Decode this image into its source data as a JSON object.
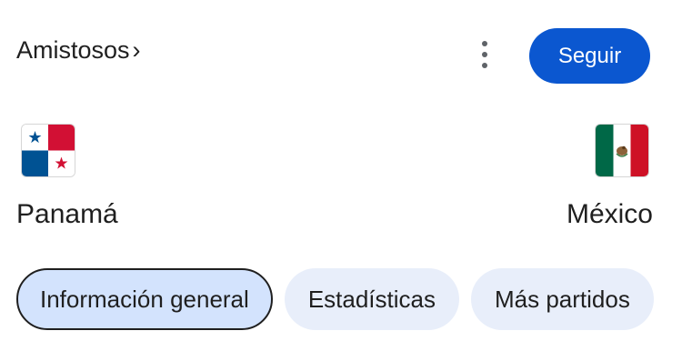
{
  "header": {
    "breadcrumb_label": "Amistosos",
    "breadcrumb_chevron": "›",
    "more_icon": "more-vert-icon",
    "follow_label": "Seguir"
  },
  "teams": {
    "home": {
      "name": "Panamá",
      "flag_icon": "panama-flag-icon"
    },
    "away": {
      "name": "México",
      "flag_icon": "mexico-flag-icon"
    }
  },
  "tabs": [
    {
      "label": "Información general",
      "selected": true
    },
    {
      "label": "Estadísticas",
      "selected": false
    },
    {
      "label": "Más partidos",
      "selected": false
    }
  ],
  "colors": {
    "accent": "#0b57d0",
    "chip_bg": "#e8eefa",
    "chip_selected_bg": "#d3e3fd",
    "text": "#1f1f1f"
  }
}
